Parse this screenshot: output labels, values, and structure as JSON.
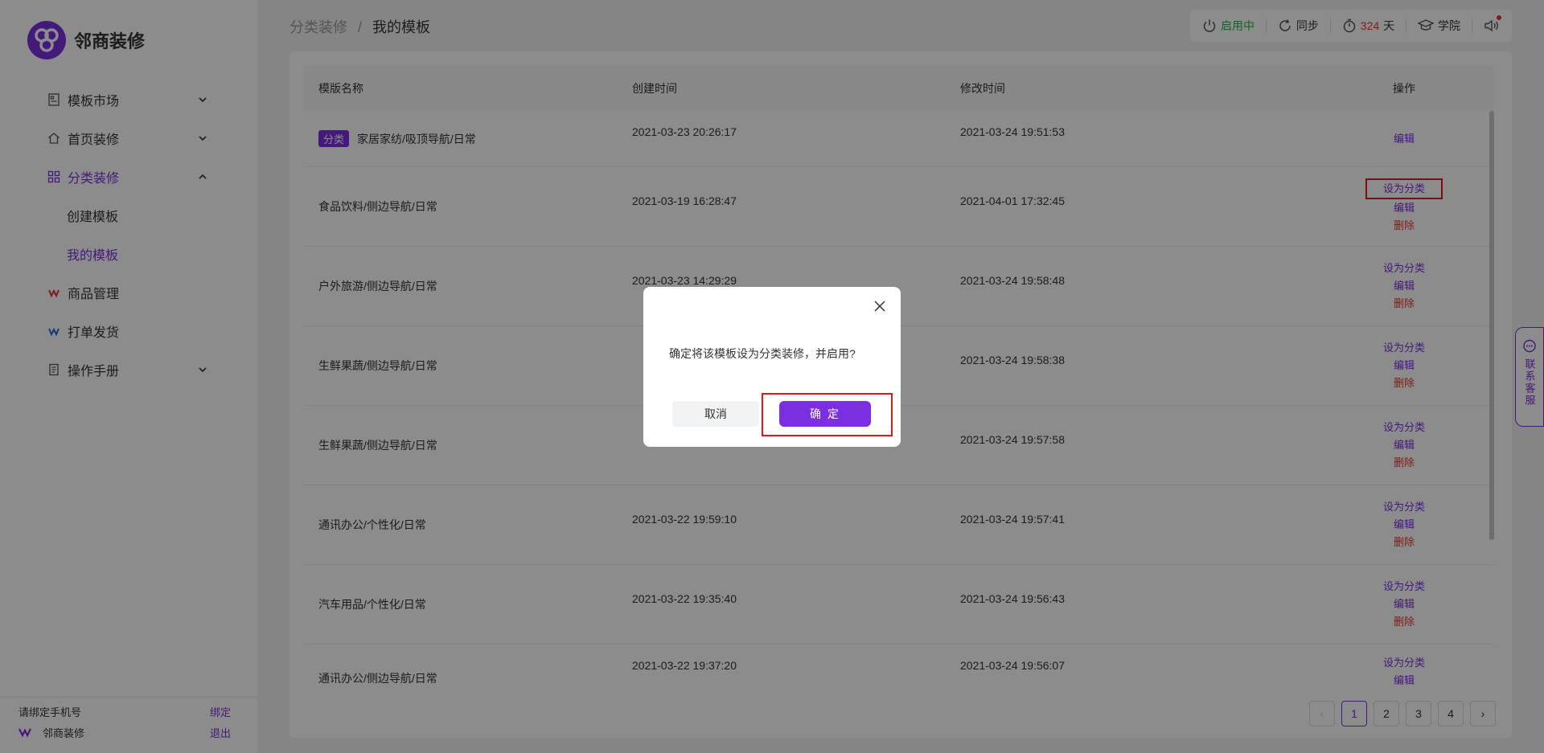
{
  "app": {
    "name": "邻商装修"
  },
  "sidebar": {
    "menu": [
      {
        "label": "模板市场",
        "icon": "template-icon",
        "expandable": true
      },
      {
        "label": "首页装修",
        "icon": "home-icon",
        "expandable": true
      },
      {
        "label": "分类装修",
        "icon": "category-icon",
        "expandable": true,
        "active": true
      },
      {
        "label": "商品管理",
        "icon": "goods-icon",
        "expandable": false
      },
      {
        "label": "打单发货",
        "icon": "shipping-icon",
        "expandable": false
      },
      {
        "label": "操作手册",
        "icon": "manual-icon",
        "expandable": true
      }
    ],
    "submenu": [
      {
        "label": "创建模板"
      },
      {
        "label": "我的模板",
        "active": true
      }
    ],
    "footer": {
      "bind_phone": "请绑定手机号",
      "bind_link": "绑定",
      "shop_name": "邻商装修",
      "logout": "退出"
    }
  },
  "breadcrumb": {
    "parent": "分类装修",
    "sep": "/",
    "current": "我的模板"
  },
  "toolbar": {
    "status": "启用中",
    "sync": "同步",
    "days_num": "324",
    "days_unit": "天",
    "academy": "学院"
  },
  "table": {
    "headers": {
      "name": "模版名称",
      "created": "创建时间",
      "modified": "修改时间",
      "ops": "操作"
    },
    "tag_label": "分类",
    "op_labels": {
      "set": "设为分类",
      "edit": "编辑",
      "delete": "删除"
    },
    "rows": [
      {
        "name": "家居家纺/吸顶导航/日常",
        "created": "2021-03-23 20:26:17",
        "modified": "2021-03-24 19:51:53"
      },
      {
        "name": "食品饮料/侧边导航/日常",
        "created": "2021-03-19 16:28:47",
        "modified": "2021-04-01 17:32:45"
      },
      {
        "name": "户外旅游/侧边导航/日常",
        "created": "2021-03-23 14:29:29",
        "modified": "2021-03-24 19:58:48"
      },
      {
        "name": "生鲜果蔬/侧边导航/日常",
        "created": "",
        "modified": "2021-03-24 19:58:38"
      },
      {
        "name": "生鲜果蔬/侧边导航/日常",
        "created": "",
        "modified": "2021-03-24 19:57:58"
      },
      {
        "name": "通讯办公/个性化/日常",
        "created": "2021-03-22 19:59:10",
        "modified": "2021-03-24 19:57:41"
      },
      {
        "name": "汽车用品/个性化/日常",
        "created": "2021-03-22 19:35:40",
        "modified": "2021-03-24 19:56:43"
      },
      {
        "name": "通讯办公/侧边导航/日常",
        "created": "2021-03-22 19:37:20",
        "modified": "2021-03-24 19:56:07"
      }
    ]
  },
  "pagination": {
    "pages": [
      "1",
      "2",
      "3",
      "4"
    ],
    "current": "1",
    "prev": "‹",
    "next": "›"
  },
  "contact": {
    "label": "联系客服"
  },
  "dialog": {
    "message": "确定将该模板设为分类装修，并启用?",
    "cancel": "取消",
    "confirm": "确 定"
  },
  "colors": {
    "accent": "#7b2fe0",
    "danger": "#e5362d",
    "status_green": "#2bb04a",
    "highlight": "#e01a1a"
  }
}
